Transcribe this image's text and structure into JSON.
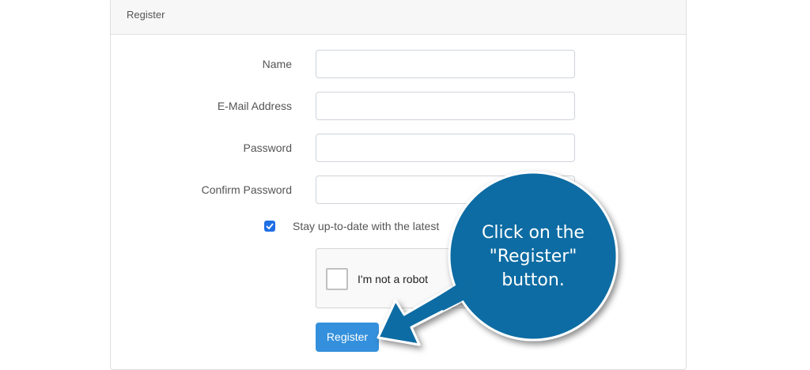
{
  "card": {
    "title": "Register"
  },
  "form": {
    "name_label": "Name",
    "email_label": "E-Mail Address",
    "password_label": "Password",
    "confirm_label": "Confirm Password",
    "newsletter_label": "Stay up-to-date with the latest",
    "newsletter_checked": true
  },
  "recaptcha": {
    "label": "I'm not a robot"
  },
  "actions": {
    "register_label": "Register"
  },
  "annotation": {
    "lines": [
      "Click on the",
      "\"Register\"",
      "button."
    ]
  },
  "colors": {
    "primary_button": "#3490dc",
    "checkbox": "#1f6fe5",
    "callout": "#0e6ca3"
  },
  "icons": {
    "checkbox_check": "check-icon",
    "callout_pointer": "arrow-icon"
  }
}
